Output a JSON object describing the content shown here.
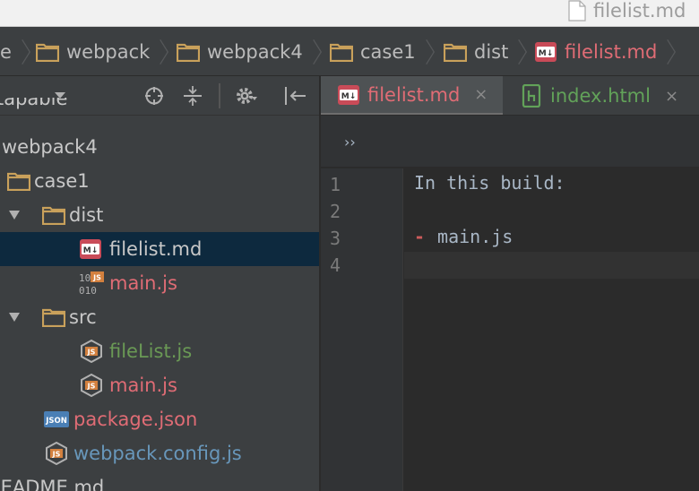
{
  "window": {
    "title": "filelist.md"
  },
  "breadcrumb": {
    "items": [
      {
        "label": "e",
        "type": "folder"
      },
      {
        "label": "webpack",
        "type": "folder"
      },
      {
        "label": "webpack4",
        "type": "folder"
      },
      {
        "label": "case1",
        "type": "folder"
      },
      {
        "label": "dist",
        "type": "folder"
      },
      {
        "label": "filelist.md",
        "type": "markdown"
      }
    ]
  },
  "project_panel": {
    "tree": [
      {
        "label": "tapable",
        "indent": 0,
        "icon": "none",
        "color": "white"
      },
      {
        "label": "webpack4",
        "indent": 0,
        "icon": "none",
        "color": "white"
      },
      {
        "label": "case1",
        "indent": 1,
        "icon": "folder",
        "color": "white"
      },
      {
        "label": "dist",
        "indent": 2,
        "icon": "folder",
        "color": "white",
        "expanded": true
      },
      {
        "label": "filelist.md",
        "indent": 3,
        "icon": "markdown",
        "color": "white",
        "selected": true
      },
      {
        "label": "main.js",
        "indent": 3,
        "icon": "binary-js",
        "color": "red"
      },
      {
        "label": "src",
        "indent": 2,
        "icon": "folder",
        "color": "white",
        "expanded": true
      },
      {
        "label": "fileList.js",
        "indent": 3,
        "icon": "js",
        "color": "green"
      },
      {
        "label": "main.js",
        "indent": 3,
        "icon": "js",
        "color": "red"
      },
      {
        "label": "package.json",
        "indent": 2,
        "icon": "json",
        "color": "red"
      },
      {
        "label": "webpack.config.js",
        "indent": 2,
        "icon": "js",
        "color": "blue"
      },
      {
        "label": "README.md",
        "indent": 0,
        "icon": "none",
        "color": "white"
      }
    ]
  },
  "tabs": [
    {
      "label": "filelist.md",
      "icon": "markdown",
      "active": true,
      "close": "×"
    },
    {
      "label": "index.html",
      "icon": "html",
      "active": false,
      "close": "×"
    }
  ],
  "editor": {
    "more": "››",
    "lines": [
      {
        "no": "1",
        "text": "In this build:"
      },
      {
        "no": "2",
        "text": ""
      },
      {
        "no": "3",
        "text": "main.js",
        "bullet": "-"
      },
      {
        "no": "4",
        "text": ""
      }
    ]
  },
  "colors": {
    "accent_red": "#e06c75",
    "selection": "#0d293e",
    "folder": "#c9a15b"
  }
}
